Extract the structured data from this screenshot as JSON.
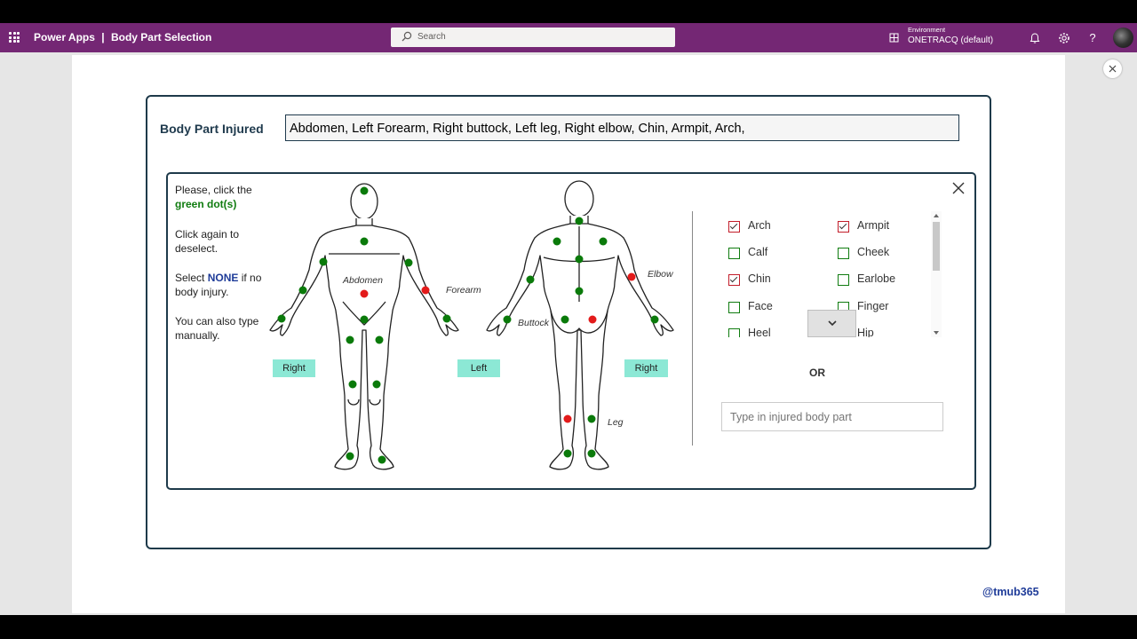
{
  "topbar": {
    "app_name": "Power Apps",
    "separator": "|",
    "page_name": "Body Part Selection",
    "search_placeholder": "Search",
    "environment_label": "Environment",
    "environment_name": "ONETRACQ (default)"
  },
  "form": {
    "body_part_label": "Body Part Injured",
    "body_part_value": "Abdomen, Left Forearm, Right buttock, Left leg, Right elbow, Chin, Armpit, Arch,"
  },
  "instructions": {
    "line1_prefix": "Please, click the",
    "line1_emphasis": "green dot(s)",
    "line2": "Click again to deselect.",
    "line3_prefix": "Select",
    "line3_emphasis": "NONE",
    "line3_suffix": "if no body injury.",
    "line4": "You can also type manually."
  },
  "diagram": {
    "side_buttons": [
      "Right",
      "Left",
      "Right"
    ],
    "labels": {
      "abdomen": "Abdomen",
      "forearm": "Forearm",
      "elbow": "Elbow",
      "buttock": "Buttock",
      "leg": "Leg"
    },
    "colors": {
      "selected": "#e31b1b",
      "unselected": "#0a7a0a"
    }
  },
  "checklist": {
    "items": [
      {
        "label": "Arch",
        "checked": true
      },
      {
        "label": "Armpit",
        "checked": true
      },
      {
        "label": "Calf",
        "checked": false
      },
      {
        "label": "Cheek",
        "checked": false
      },
      {
        "label": "Chin",
        "checked": true
      },
      {
        "label": "Earlobe",
        "checked": false
      },
      {
        "label": "Face",
        "checked": false
      },
      {
        "label": "Finger",
        "checked": false
      },
      {
        "label": "Heel",
        "checked": false
      },
      {
        "label": "Hip",
        "checked": false
      }
    ]
  },
  "or_label": "OR",
  "manual_input": {
    "placeholder": "Type in injured body part",
    "value": ""
  },
  "credit": "@tmub365"
}
